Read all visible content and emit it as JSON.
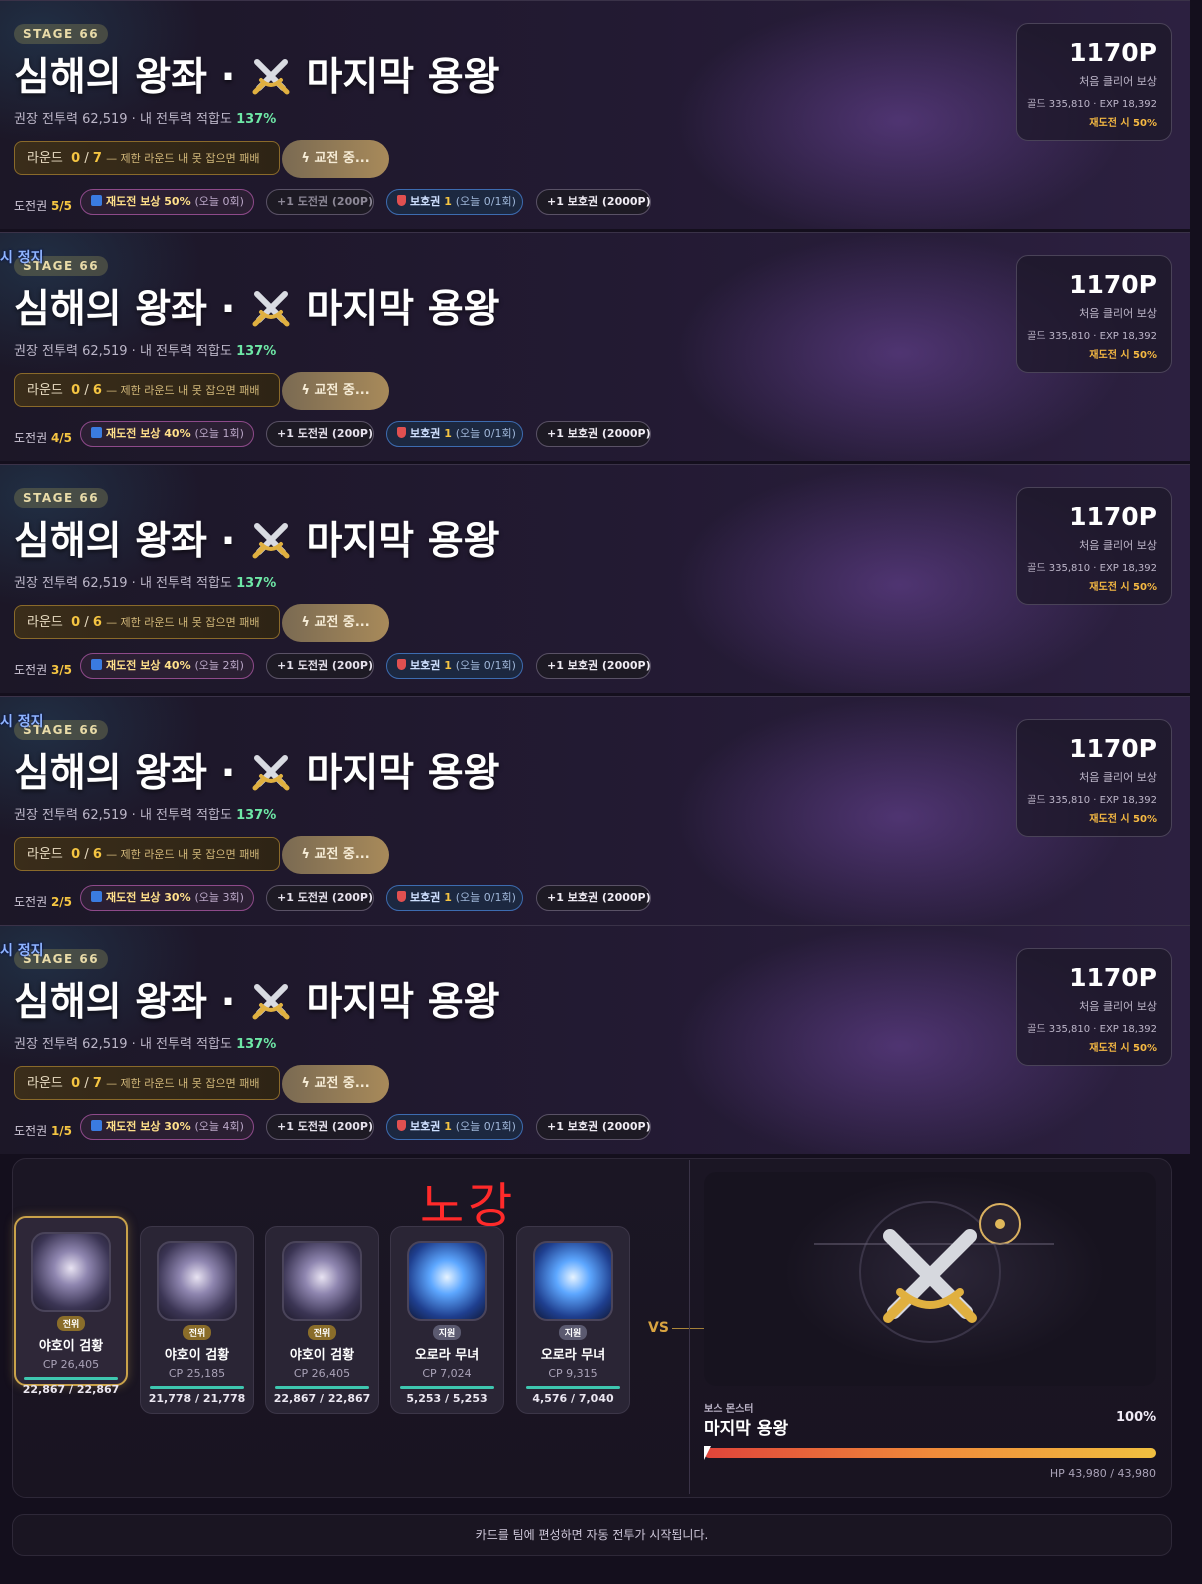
{
  "stage_tag": "STAGE 66",
  "pause_label": "시 정지",
  "title_part1": "심해의 왕좌",
  "title_dot": "·",
  "title_part2": "마지막 용왕",
  "recommended_label": "권장 전투력 62,519 · 내 전투력 적합도",
  "fitness_pct": "137%",
  "round_label": "라운드",
  "round_sep": "/",
  "round_limit_text": "— 제한 라운드 내 못 잡으면 패배",
  "fight_button": "교전 중...",
  "ticket_label": "도전권",
  "retry_reward_label": "재도전 보상",
  "buy_ticket_label": "+1 도전권 (200P)",
  "shield_label": "보호권",
  "shield_count": "1",
  "shield_today": "(오늘 0/1회)",
  "buy_shield_label": "+1 보호권 (2000P)",
  "reward": {
    "points": "1170P",
    "label": "처음 클리어 보상",
    "detail": "골드 335,810 · EXP 18,392",
    "retry_rate": "재도전 시 50%"
  },
  "panels": [
    {
      "round_current": "0",
      "round_max": "7",
      "tickets": "5/5",
      "retry_pct": "50%",
      "retry_today": "(오늘 0회)",
      "paused": false,
      "buy_dim": true
    },
    {
      "round_current": "0",
      "round_max": "6",
      "tickets": "4/5",
      "retry_pct": "40%",
      "retry_today": "(오늘 1회)",
      "paused": true,
      "buy_dim": false
    },
    {
      "round_current": "0",
      "round_max": "6",
      "tickets": "3/5",
      "retry_pct": "40%",
      "retry_today": "(오늘 2회)",
      "paused": false,
      "buy_dim": false
    },
    {
      "round_current": "0",
      "round_max": "6",
      "tickets": "2/5",
      "retry_pct": "30%",
      "retry_today": "(오늘 3회)",
      "paused": true,
      "buy_dim": false
    },
    {
      "round_current": "0",
      "round_max": "7",
      "tickets": "1/5",
      "retry_pct": "30%",
      "retry_today": "(오늘 4회)",
      "paused": true,
      "buy_dim": false
    }
  ],
  "annotation": "노강",
  "team": [
    {
      "role": "전위",
      "name": "야호이 검황",
      "cp": "CP 26,405",
      "hp": "22,867 / 22,867",
      "type": "front",
      "active": true
    },
    {
      "role": "전위",
      "name": "야호이 검황",
      "cp": "CP 25,185",
      "hp": "21,778 / 21,778",
      "type": "front",
      "active": false
    },
    {
      "role": "전위",
      "name": "야호이 검황",
      "cp": "CP 26,405",
      "hp": "22,867 / 22,867",
      "type": "front",
      "active": false
    },
    {
      "role": "지원",
      "name": "오로라 무녀",
      "cp": "CP 7,024",
      "hp": "5,253 / 5,253",
      "type": "support",
      "active": false
    },
    {
      "role": "지원",
      "name": "오로라 무녀",
      "cp": "CP 9,315",
      "hp": "4,576 / 7,040",
      "type": "support",
      "active": false
    }
  ],
  "vs": "VS",
  "boss": {
    "label": "보스 몬스터",
    "name": "마지막 용왕",
    "hp_pct_text": "100%",
    "hp_fraction": 1.0,
    "hp": "HP 43,980 / 43,980"
  },
  "footer": "카드를 팀에 편성하면 자동 전투가 시작됩니다."
}
